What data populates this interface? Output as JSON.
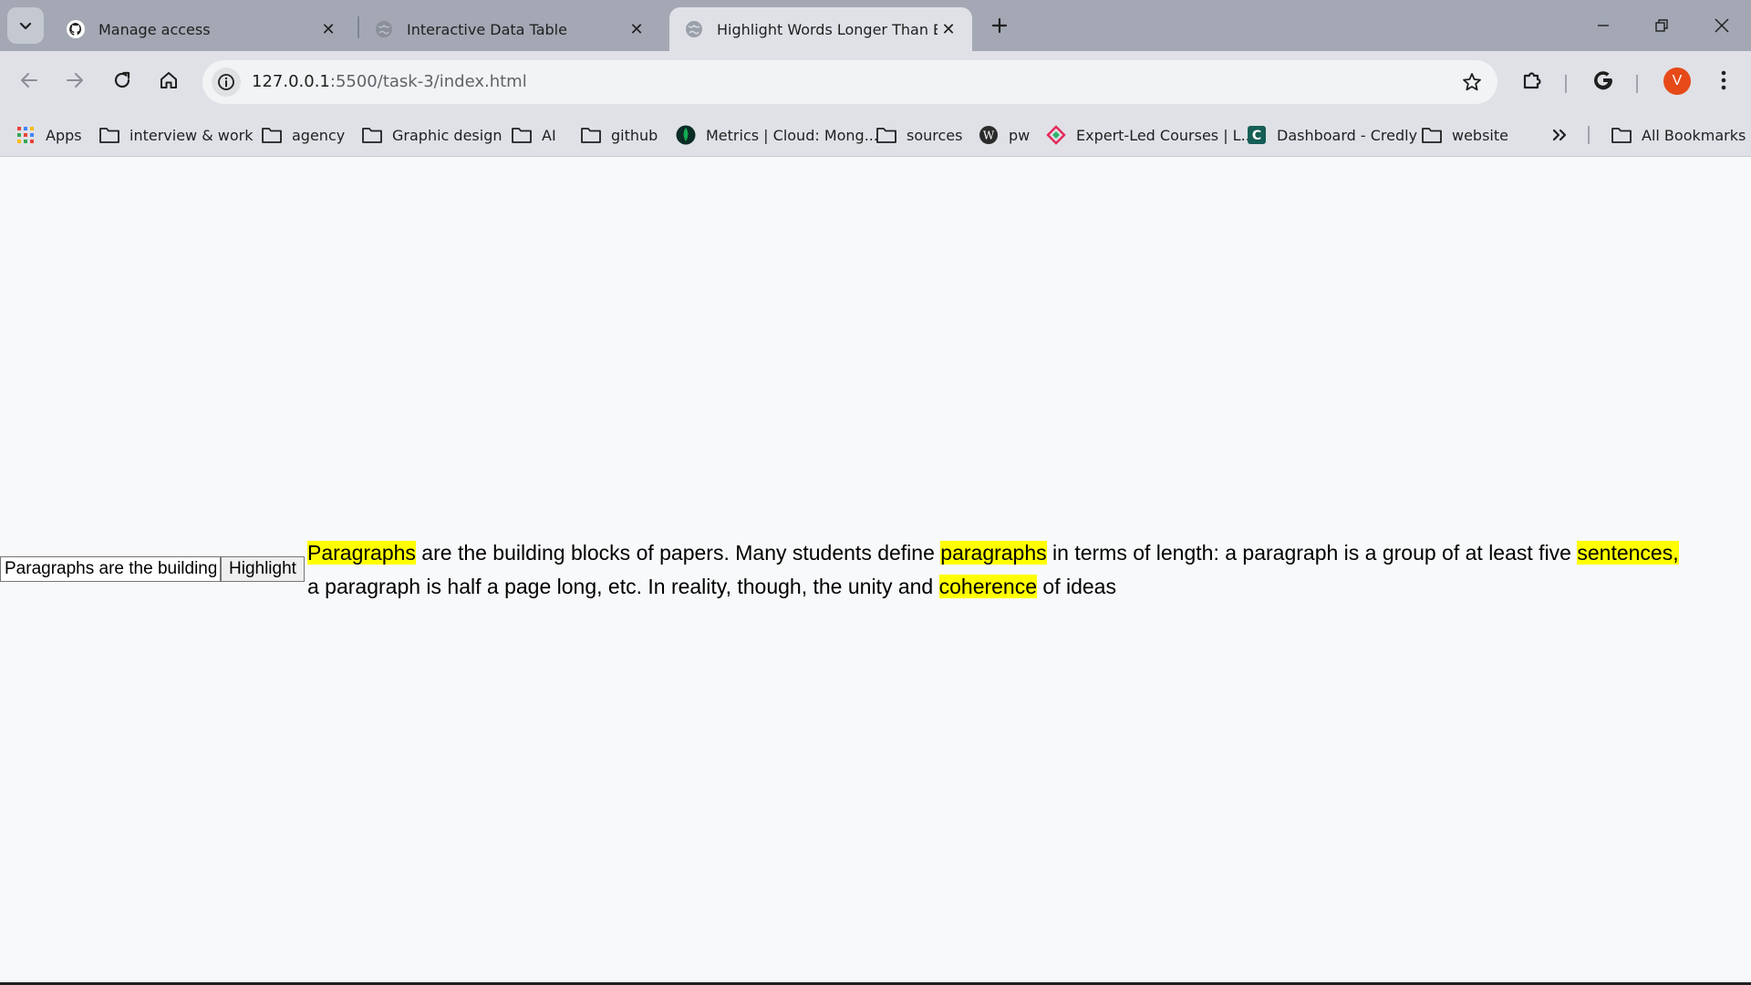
{
  "browser": {
    "tabs": [
      {
        "title": "Manage access",
        "favicon": "github-icon",
        "active": false
      },
      {
        "title": "Interactive Data Table",
        "favicon": "globe-icon",
        "active": false
      },
      {
        "title": "Highlight Words Longer Than Eight",
        "favicon": "globe-icon",
        "active": true
      }
    ],
    "url": {
      "host": "127.0.0.1",
      "path": ":5500/task-3/index.html"
    },
    "avatar_letter": "V",
    "accent": "#e64a19"
  },
  "bookmarks": [
    {
      "label": "Apps",
      "icon": "apps-grid-icon"
    },
    {
      "label": "interview & work",
      "icon": "folder-icon"
    },
    {
      "label": "agency",
      "icon": "folder-icon"
    },
    {
      "label": "Graphic design",
      "icon": "folder-icon"
    },
    {
      "label": "AI",
      "icon": "folder-icon"
    },
    {
      "label": "github",
      "icon": "folder-icon"
    },
    {
      "label": "Metrics | Cloud: Mong...",
      "icon": "mongodb-icon"
    },
    {
      "label": "sources",
      "icon": "folder-icon"
    },
    {
      "label": "pw",
      "icon": "wordpress-icon"
    },
    {
      "label": "Expert-Led Courses | L...",
      "icon": "pluralsight-icon"
    },
    {
      "label": "Dashboard - Credly",
      "icon": "credly-icon"
    },
    {
      "label": "website",
      "icon": "folder-icon"
    },
    {
      "label": "All Bookmarks",
      "icon": "folder-icon"
    }
  ],
  "page": {
    "input_value": "Paragraphs are the building blocks of papers. Many students define paragraphs in terms of length: a paragraph is a group of at least five sentences, a paragraph is half a page long, etc. In reality, though, the unity and coherence of ideas",
    "button_label": "Highlight",
    "highlight_color": "#ffff00",
    "paragraph": [
      {
        "text": "Paragraphs",
        "highlighted": true
      },
      {
        "text": " are the building blocks of papers. Many students define ",
        "highlighted": false
      },
      {
        "text": "paragraphs",
        "highlighted": true
      },
      {
        "text": " in terms of length: a paragraph is a group of at least five ",
        "highlighted": false
      },
      {
        "text": "sentences,",
        "highlighted": true
      },
      {
        "text": " a paragraph is half a page long, etc. In reality, though, the unity and ",
        "highlighted": false
      },
      {
        "text": "coherence",
        "highlighted": true
      },
      {
        "text": " of ideas",
        "highlighted": false
      }
    ]
  }
}
